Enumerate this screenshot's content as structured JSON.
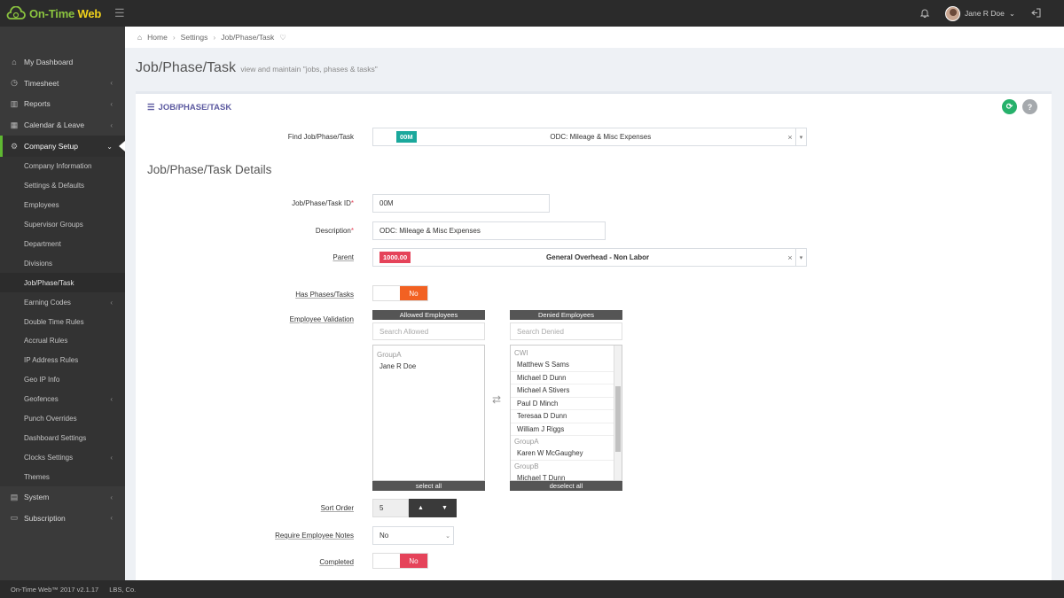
{
  "app": {
    "logo_main": "On-Time",
    "logo_web": " Web"
  },
  "topbar": {
    "user_name": "Jane R Doe"
  },
  "sidebar": {
    "items": [
      {
        "label": "My Dashboard"
      },
      {
        "label": "Timesheet"
      },
      {
        "label": "Reports"
      },
      {
        "label": "Calendar & Leave"
      },
      {
        "label": "Company Setup"
      }
    ],
    "sub_items": [
      {
        "label": "Company Information"
      },
      {
        "label": "Settings & Defaults"
      },
      {
        "label": "Employees"
      },
      {
        "label": "Supervisor Groups"
      },
      {
        "label": "Department"
      },
      {
        "label": "Divisions"
      },
      {
        "label": "Job/Phase/Task"
      },
      {
        "label": "Earning Codes"
      },
      {
        "label": "Double Time Rules"
      },
      {
        "label": "Accrual Rules"
      },
      {
        "label": "IP Address Rules"
      },
      {
        "label": "Geo IP Info"
      },
      {
        "label": "Geofences"
      },
      {
        "label": "Punch Overrides"
      },
      {
        "label": "Dashboard Settings"
      },
      {
        "label": "Clocks Settings"
      },
      {
        "label": "Themes"
      }
    ],
    "bottom_items": [
      {
        "label": "System"
      },
      {
        "label": "Subscription"
      }
    ]
  },
  "breadcrumb": {
    "home": "Home",
    "settings": "Settings",
    "current": "Job/Phase/Task"
  },
  "page": {
    "title": "Job/Phase/Task",
    "subtitle": "view and maintain \"jobs, phases & tasks\""
  },
  "portlet": {
    "title": "JOB/PHASE/TASK",
    "help": "?"
  },
  "find": {
    "label": "Find Job/Phase/Task",
    "tag": "00M",
    "value": "ODC: Mileage & Misc Expenses",
    "tag_color": "#1aa89c"
  },
  "details": {
    "title": "Job/Phase/Task Details",
    "id_label": "Job/Phase/Task ID",
    "id_value": "00M",
    "desc_label": "Description",
    "desc_value": "ODC: Mileage & Misc Expenses",
    "parent_label": "Parent",
    "parent_tag": "1000.00",
    "parent_value": "General Overhead - Non Labor",
    "parent_tag_color": "#e5435a",
    "has_phases_label": "Has Phases/Tasks",
    "has_phases_value": "No",
    "emp_validation_label": "Employee Validation",
    "sort_label": "Sort Order",
    "sort_value": "5",
    "notes_label": "Require Employee Notes",
    "notes_value": "No",
    "completed_label": "Completed",
    "completed_value": "No"
  },
  "allowed": {
    "header": "Allowed Employees",
    "search_placeholder": "Search Allowed",
    "group": "GroupA",
    "items": [
      "Jane R Doe"
    ],
    "footer": "select all"
  },
  "denied": {
    "header": "Denied Employees",
    "search_placeholder": "Search Denied",
    "group1": "CWI",
    "items1": [
      "Matthew S Sams",
      "Michael D Dunn",
      "Michael A Stivers",
      "Paul D Minch",
      "Teresaa D Dunn",
      "William J Riggs"
    ],
    "group2": "GroupA",
    "items2": [
      "Karen W McGaughey"
    ],
    "group3": "GroupB",
    "items3": [
      "Michael T Dunn"
    ],
    "footer": "deselect all"
  },
  "colors": {
    "accent_green": "#5fb832",
    "toggle_orange": "#f26122",
    "toggle_red": "#e5435a"
  },
  "footer": {
    "version": "On-Time Web™ 2017 v2.1.17",
    "company": "LBS, Co."
  }
}
